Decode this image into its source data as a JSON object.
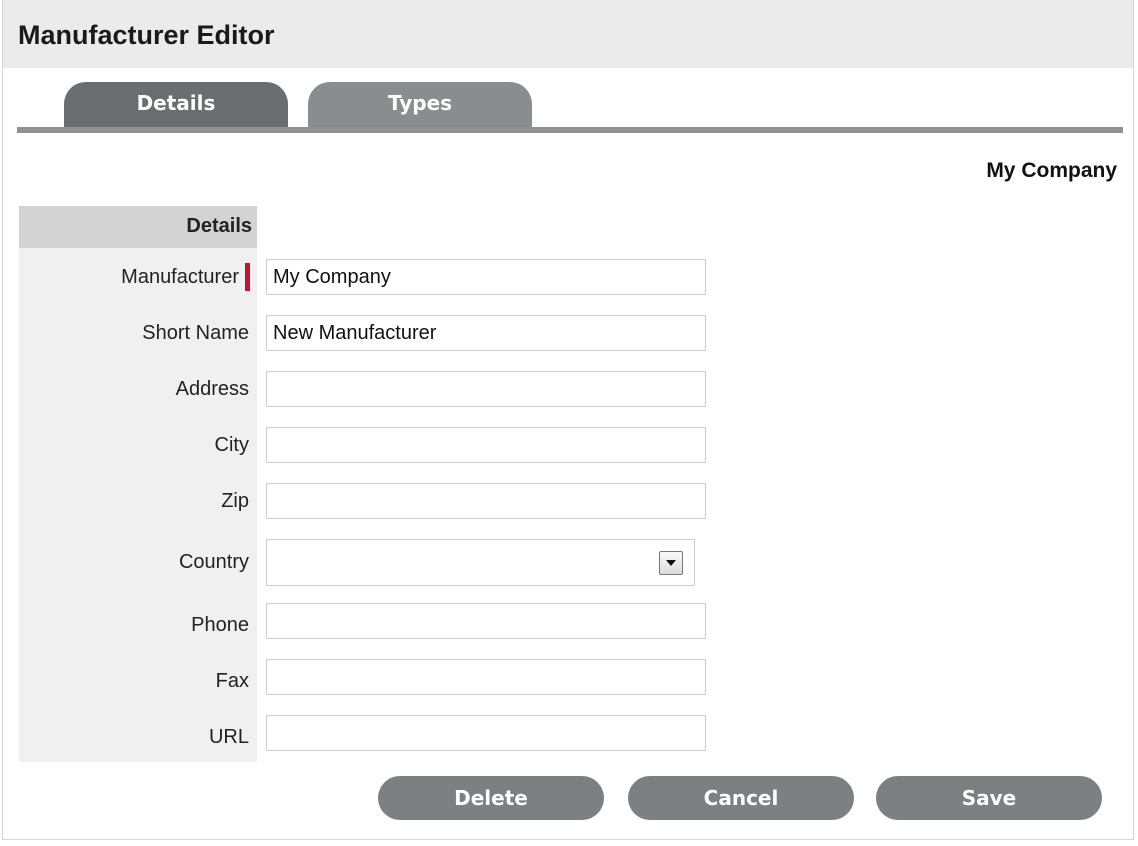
{
  "window": {
    "title": "Manufacturer Editor"
  },
  "tabs": [
    {
      "label": "Details",
      "active": true
    },
    {
      "label": "Types",
      "active": false
    }
  ],
  "context_label": "My Company",
  "section": {
    "title": "Details"
  },
  "form": {
    "manufacturer": {
      "label": "Manufacturer",
      "value": "My Company",
      "required": true
    },
    "short_name": {
      "label": "Short Name",
      "value": "New Manufacturer"
    },
    "address": {
      "label": "Address",
      "value": ""
    },
    "city": {
      "label": "City",
      "value": ""
    },
    "zip": {
      "label": "Zip",
      "value": ""
    },
    "country": {
      "label": "Country",
      "value": ""
    },
    "phone": {
      "label": "Phone",
      "value": ""
    },
    "fax": {
      "label": "Fax",
      "value": ""
    },
    "url": {
      "label": "URL",
      "value": ""
    }
  },
  "buttons": {
    "delete": "Delete",
    "cancel": "Cancel",
    "save": "Save"
  },
  "colors": {
    "tab_active": "#6b6e70",
    "tab_inactive": "#8a8d8f",
    "button": "#7d8082",
    "required_marker": "#c8102e"
  }
}
